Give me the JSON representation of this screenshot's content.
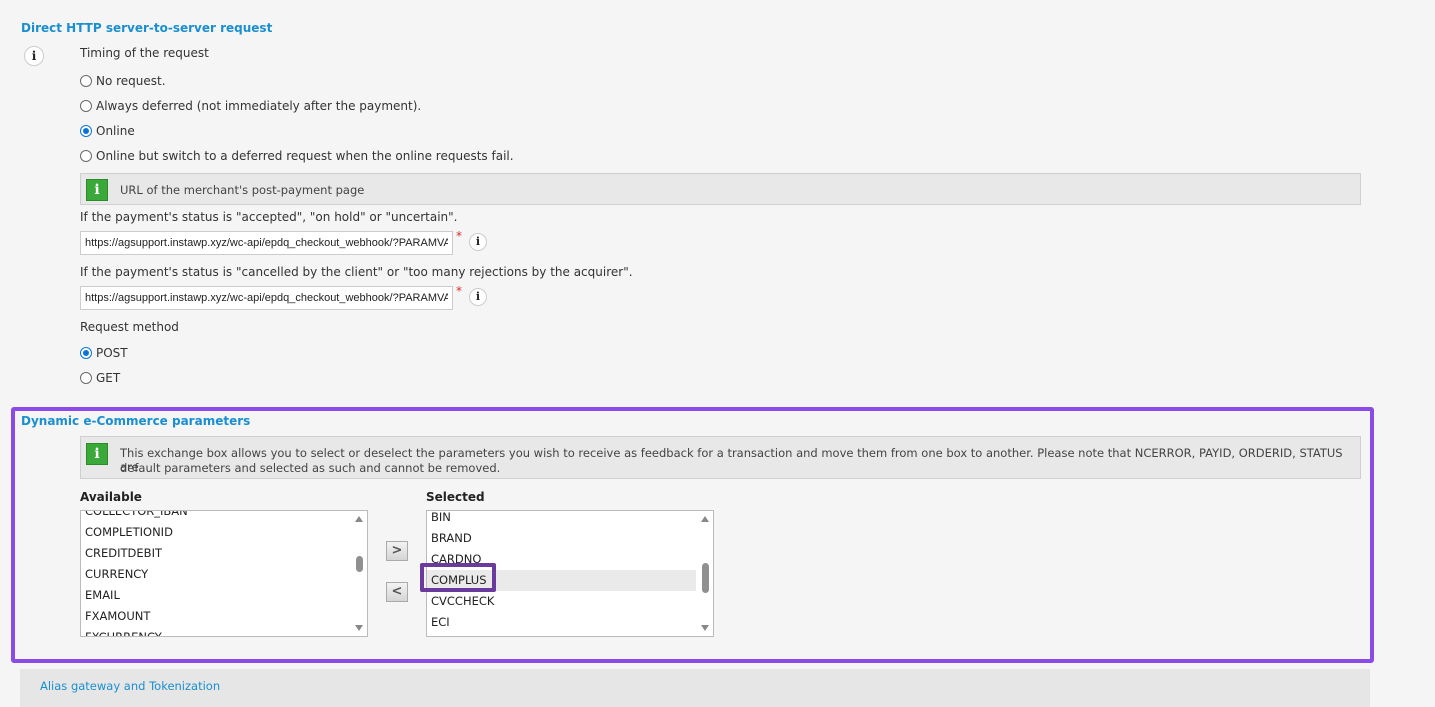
{
  "http_section": {
    "title": "Direct HTTP server-to-server request",
    "timing_label": "Timing of the request",
    "timing_options": [
      {
        "label": "No request.",
        "checked": false
      },
      {
        "label": "Always deferred (not immediately after the payment).",
        "checked": false
      },
      {
        "label": "Online",
        "checked": true
      },
      {
        "label": "Online but switch to a deferred request when the online requests fail.",
        "checked": false
      }
    ],
    "url_info": "URL of the merchant's post-payment page",
    "accepted_label": "If the payment's status is \"accepted\", \"on hold\" or \"uncertain\".",
    "accepted_url": "https://agsupport.instawp.xyz/wc-api/epdq_checkout_webhook/?PARAMVA",
    "cancelled_label": "If the payment's status is \"cancelled by the client\" or \"too many rejections by the acquirer\".",
    "cancelled_url": "https://agsupport.instawp.xyz/wc-api/epdq_checkout_webhook/?PARAMVA",
    "required_mark": "*",
    "method_label": "Request method",
    "method_options": [
      {
        "label": "POST",
        "checked": true
      },
      {
        "label": "GET",
        "checked": false
      }
    ]
  },
  "dynamic_section": {
    "title": "Dynamic e-Commerce parameters",
    "info_line1": "This exchange box allows you to select or deselect the parameters you wish to receive as feedback for a transaction and move them from one box to another. Please note that NCERROR, PAYID, ORDERID, STATUS are",
    "info_line2": "default parameters and selected as such and cannot be removed.",
    "available_label": "Available",
    "selected_label": "Selected",
    "available_items": [
      "COLLECTOR_IBAN",
      "COMPLETIONID",
      "CREDITDEBIT",
      "CURRENCY",
      "EMAIL",
      "FXAMOUNT",
      "FXCURRENCY"
    ],
    "selected_items": [
      "BIN",
      "BRAND",
      "CARDNO",
      "COMPLUS",
      "CVCCHECK",
      "ECI"
    ],
    "move_right": ">",
    "move_left": "<"
  },
  "info_icon": "i",
  "footer": {
    "alias_link": "Alias gateway and Tokenization"
  },
  "colors": {
    "accent": "#1a8fd0",
    "highlight": "#8b4be8",
    "highlight_inner": "#6a3a9c",
    "info_green": "#3aa93a"
  }
}
